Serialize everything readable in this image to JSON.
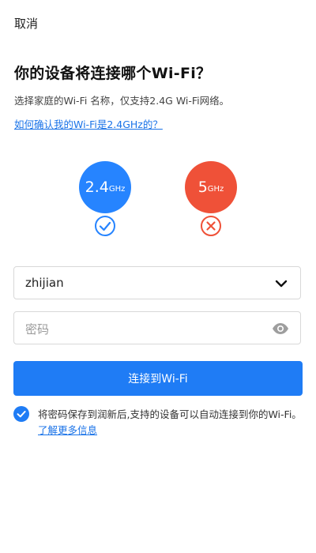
{
  "header": {
    "cancel_label": "取消"
  },
  "main": {
    "title": "你的设备将连接哪个Wi-Fi？",
    "subtitle": "选择家庭的Wi-Fi 名称，仅支持2.4G Wi-Fi网络。",
    "help_link": "如何确认我的Wi-Fi是2.4GHz的？"
  },
  "bands": [
    {
      "value": "2.4",
      "unit": "GHz",
      "color": "#2684ff",
      "status": "supported",
      "status_icon": "check-circle-icon"
    },
    {
      "value": "5",
      "unit": "GHz",
      "color": "#ef5138",
      "status": "unsupported",
      "status_icon": "x-circle-icon"
    }
  ],
  "form": {
    "ssid_value": "zhijian",
    "password_placeholder": "密码",
    "connect_label": "连接到Wi-Fi"
  },
  "consent": {
    "checked": true,
    "text": "将密码保存到润新后,支持的设备可以自动连接到你的Wi-Fi。",
    "link": "了解更多信息"
  },
  "colors": {
    "accent": "#1f7cf5",
    "error": "#ef5138",
    "link": "#1a73e8"
  }
}
